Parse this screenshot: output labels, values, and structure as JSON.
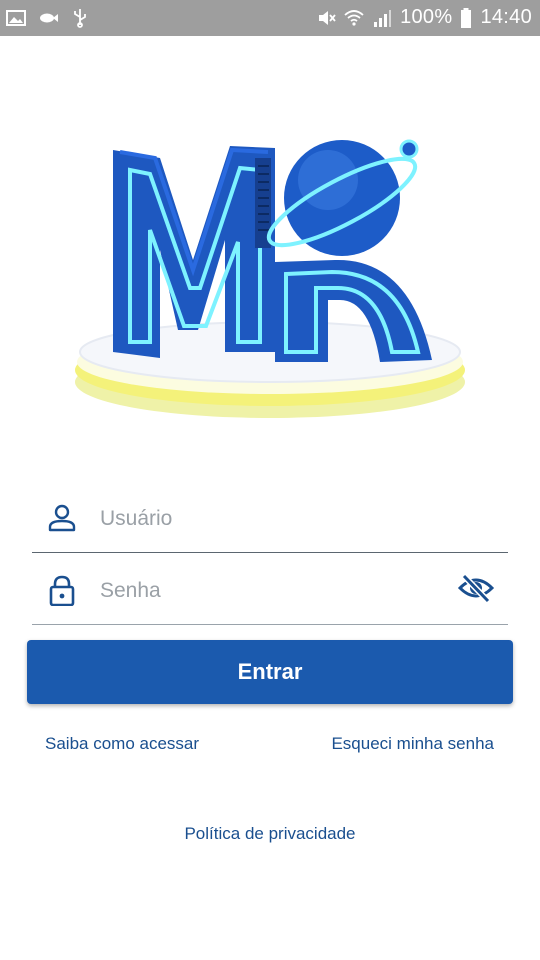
{
  "status_bar": {
    "battery": "100%",
    "time": "14:40",
    "icons": [
      "image-icon",
      "fish-icon",
      "usb-icon",
      "mute-icon",
      "wifi-icon",
      "signal-icon",
      "battery-icon"
    ]
  },
  "logo": {
    "brand": "Mn"
  },
  "login": {
    "username_placeholder": "Usuário",
    "password_placeholder": "Senha",
    "submit_label": "Entrar"
  },
  "links": {
    "how_to_access": "Saiba como acessar",
    "forgot_password": "Esqueci minha senha",
    "privacy_policy": "Política de privacidade"
  },
  "colors": {
    "primary": "#1b5aae",
    "link": "#1a4f8f",
    "status_bar": "#9e9e9e",
    "logo_blue": "#1f5fc4",
    "logo_yellow": "#f4f27a"
  }
}
